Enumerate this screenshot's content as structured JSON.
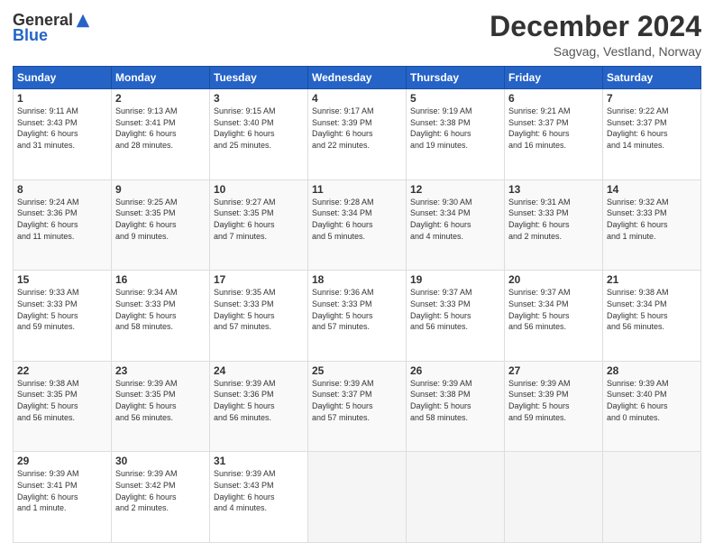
{
  "header": {
    "logo_general": "General",
    "logo_blue": "Blue",
    "month_title": "December 2024",
    "location": "Sagvag, Vestland, Norway"
  },
  "weekdays": [
    "Sunday",
    "Monday",
    "Tuesday",
    "Wednesday",
    "Thursday",
    "Friday",
    "Saturday"
  ],
  "weeks": [
    [
      {
        "day": "1",
        "info": "Sunrise: 9:11 AM\nSunset: 3:43 PM\nDaylight: 6 hours\nand 31 minutes."
      },
      {
        "day": "2",
        "info": "Sunrise: 9:13 AM\nSunset: 3:41 PM\nDaylight: 6 hours\nand 28 minutes."
      },
      {
        "day": "3",
        "info": "Sunrise: 9:15 AM\nSunset: 3:40 PM\nDaylight: 6 hours\nand 25 minutes."
      },
      {
        "day": "4",
        "info": "Sunrise: 9:17 AM\nSunset: 3:39 PM\nDaylight: 6 hours\nand 22 minutes."
      },
      {
        "day": "5",
        "info": "Sunrise: 9:19 AM\nSunset: 3:38 PM\nDaylight: 6 hours\nand 19 minutes."
      },
      {
        "day": "6",
        "info": "Sunrise: 9:21 AM\nSunset: 3:37 PM\nDaylight: 6 hours\nand 16 minutes."
      },
      {
        "day": "7",
        "info": "Sunrise: 9:22 AM\nSunset: 3:37 PM\nDaylight: 6 hours\nand 14 minutes."
      }
    ],
    [
      {
        "day": "8",
        "info": "Sunrise: 9:24 AM\nSunset: 3:36 PM\nDaylight: 6 hours\nand 11 minutes."
      },
      {
        "day": "9",
        "info": "Sunrise: 9:25 AM\nSunset: 3:35 PM\nDaylight: 6 hours\nand 9 minutes."
      },
      {
        "day": "10",
        "info": "Sunrise: 9:27 AM\nSunset: 3:35 PM\nDaylight: 6 hours\nand 7 minutes."
      },
      {
        "day": "11",
        "info": "Sunrise: 9:28 AM\nSunset: 3:34 PM\nDaylight: 6 hours\nand 5 minutes."
      },
      {
        "day": "12",
        "info": "Sunrise: 9:30 AM\nSunset: 3:34 PM\nDaylight: 6 hours\nand 4 minutes."
      },
      {
        "day": "13",
        "info": "Sunrise: 9:31 AM\nSunset: 3:33 PM\nDaylight: 6 hours\nand 2 minutes."
      },
      {
        "day": "14",
        "info": "Sunrise: 9:32 AM\nSunset: 3:33 PM\nDaylight: 6 hours\nand 1 minute."
      }
    ],
    [
      {
        "day": "15",
        "info": "Sunrise: 9:33 AM\nSunset: 3:33 PM\nDaylight: 5 hours\nand 59 minutes."
      },
      {
        "day": "16",
        "info": "Sunrise: 9:34 AM\nSunset: 3:33 PM\nDaylight: 5 hours\nand 58 minutes."
      },
      {
        "day": "17",
        "info": "Sunrise: 9:35 AM\nSunset: 3:33 PM\nDaylight: 5 hours\nand 57 minutes."
      },
      {
        "day": "18",
        "info": "Sunrise: 9:36 AM\nSunset: 3:33 PM\nDaylight: 5 hours\nand 57 minutes."
      },
      {
        "day": "19",
        "info": "Sunrise: 9:37 AM\nSunset: 3:33 PM\nDaylight: 5 hours\nand 56 minutes."
      },
      {
        "day": "20",
        "info": "Sunrise: 9:37 AM\nSunset: 3:34 PM\nDaylight: 5 hours\nand 56 minutes."
      },
      {
        "day": "21",
        "info": "Sunrise: 9:38 AM\nSunset: 3:34 PM\nDaylight: 5 hours\nand 56 minutes."
      }
    ],
    [
      {
        "day": "22",
        "info": "Sunrise: 9:38 AM\nSunset: 3:35 PM\nDaylight: 5 hours\nand 56 minutes."
      },
      {
        "day": "23",
        "info": "Sunrise: 9:39 AM\nSunset: 3:35 PM\nDaylight: 5 hours\nand 56 minutes."
      },
      {
        "day": "24",
        "info": "Sunrise: 9:39 AM\nSunset: 3:36 PM\nDaylight: 5 hours\nand 56 minutes."
      },
      {
        "day": "25",
        "info": "Sunrise: 9:39 AM\nSunset: 3:37 PM\nDaylight: 5 hours\nand 57 minutes."
      },
      {
        "day": "26",
        "info": "Sunrise: 9:39 AM\nSunset: 3:38 PM\nDaylight: 5 hours\nand 58 minutes."
      },
      {
        "day": "27",
        "info": "Sunrise: 9:39 AM\nSunset: 3:39 PM\nDaylight: 5 hours\nand 59 minutes."
      },
      {
        "day": "28",
        "info": "Sunrise: 9:39 AM\nSunset: 3:40 PM\nDaylight: 6 hours\nand 0 minutes."
      }
    ],
    [
      {
        "day": "29",
        "info": "Sunrise: 9:39 AM\nSunset: 3:41 PM\nDaylight: 6 hours\nand 1 minute."
      },
      {
        "day": "30",
        "info": "Sunrise: 9:39 AM\nSunset: 3:42 PM\nDaylight: 6 hours\nand 2 minutes."
      },
      {
        "day": "31",
        "info": "Sunrise: 9:39 AM\nSunset: 3:43 PM\nDaylight: 6 hours\nand 4 minutes."
      },
      {
        "day": "",
        "info": ""
      },
      {
        "day": "",
        "info": ""
      },
      {
        "day": "",
        "info": ""
      },
      {
        "day": "",
        "info": ""
      }
    ]
  ]
}
